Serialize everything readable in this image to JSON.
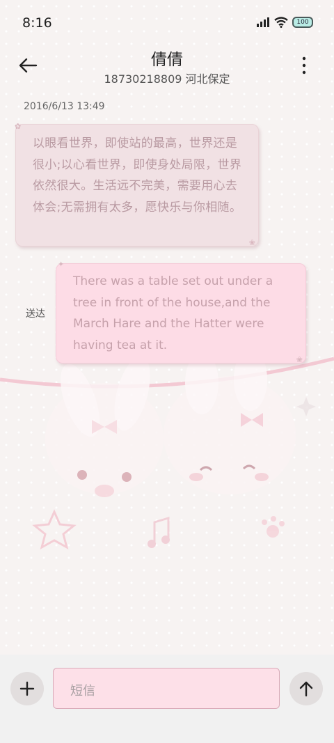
{
  "status_bar": {
    "time": "8:16",
    "battery_level": "100"
  },
  "header": {
    "contact_name": "倩倩",
    "contact_subtitle": "18730218809 河北保定",
    "back_icon": "arrow-left-icon",
    "more_icon": "more-vertical-icon"
  },
  "conversation": {
    "timestamp": "2016/6/13 13:49",
    "messages": [
      {
        "direction": "incoming",
        "text": "以眼看世界，即使站的最高，世界还是很小;以心看世界，即使身处局限，世界依然很大。生活远不完美，需要用心去体会;无需拥有太多，愿快乐与你相随。"
      },
      {
        "direction": "outgoing",
        "text": "There was a table set out under a tree in front of the house,and the March Hare and the Hatter were having tea at it.",
        "status": "送达"
      }
    ]
  },
  "composer": {
    "placeholder": "短信",
    "add_icon": "plus-icon",
    "send_icon": "arrow-up-icon"
  },
  "theme": {
    "incoming_bubble_color": "#f1e1e4",
    "outgoing_bubble_color": "#fddce6",
    "input_border_color": "#d9aab8"
  }
}
